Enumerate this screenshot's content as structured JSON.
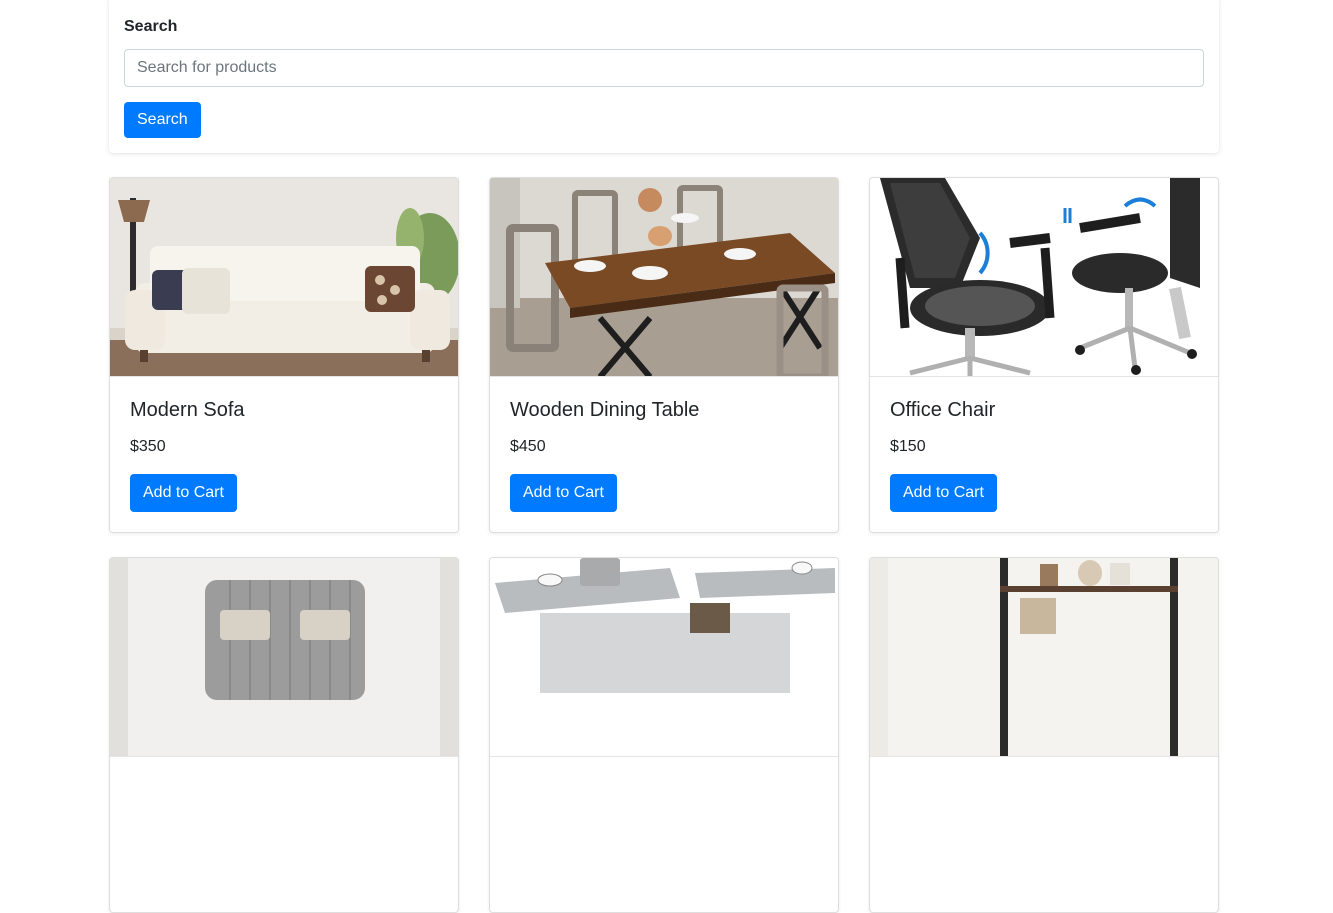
{
  "search": {
    "label": "Search",
    "placeholder": "Search for products",
    "value": "",
    "button_label": "Search"
  },
  "products": [
    {
      "name": "Modern Sofa",
      "price": "$350",
      "button_label": "Add to Cart",
      "image": "sofa-image"
    },
    {
      "name": "Wooden Dining Table",
      "price": "$450",
      "button_label": "Add to Cart",
      "image": "dining-table-image"
    },
    {
      "name": "Office Chair",
      "price": "$150",
      "button_label": "Add to Cart",
      "image": "office-chair-image"
    }
  ],
  "partial_products": [
    {
      "image": "bed-image"
    },
    {
      "image": "lift-top-coffee-table-image"
    },
    {
      "image": "bookshelf-image"
    }
  ],
  "colors": {
    "primary": "#007bff",
    "text": "#212529",
    "border": "#ced4da"
  }
}
